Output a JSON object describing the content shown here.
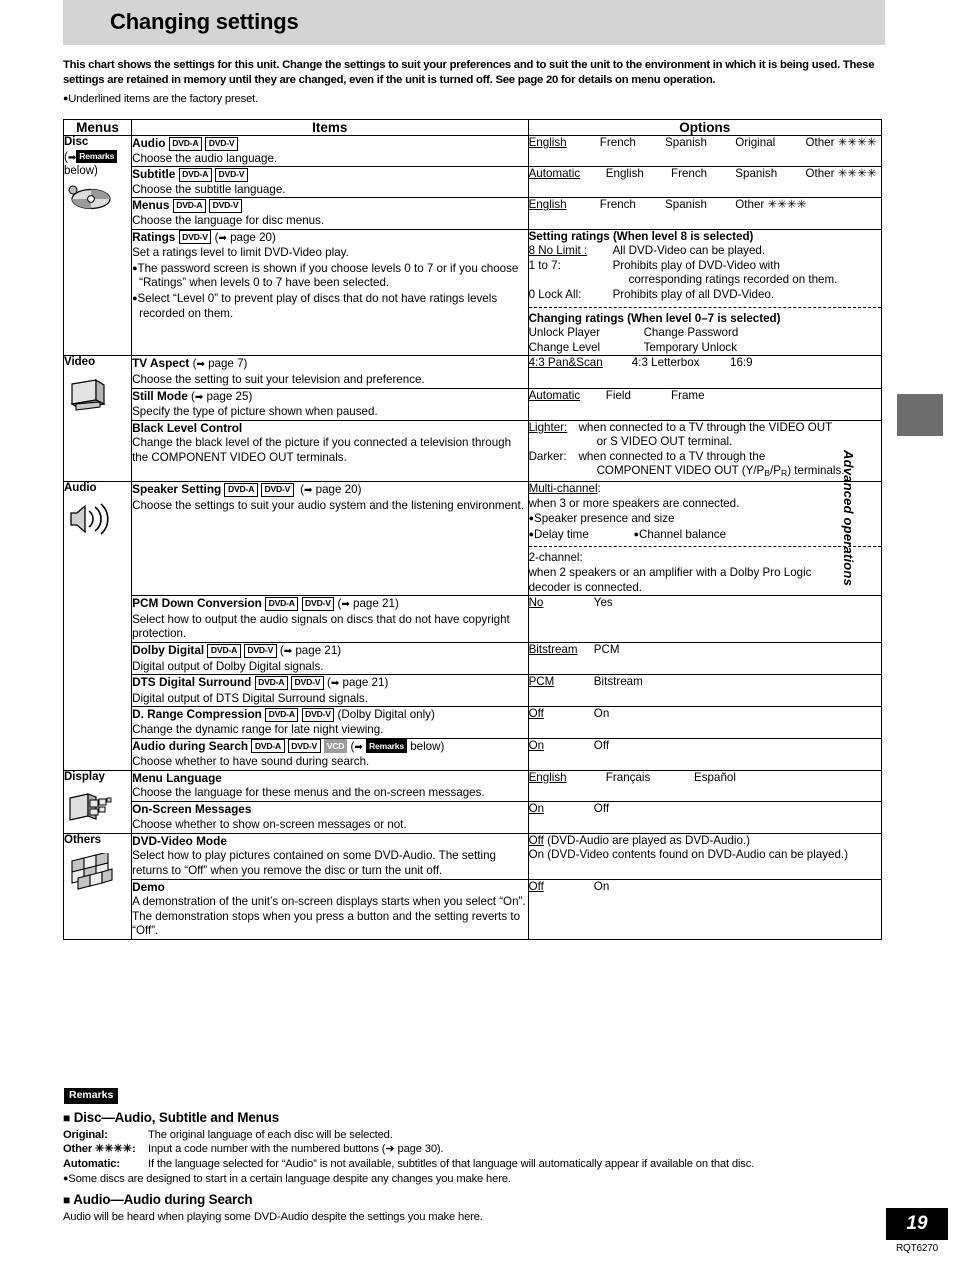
{
  "page": {
    "title": "Changing settings",
    "intro": "This chart shows the settings for this unit. Change the settings to suit your preferences and to suit the unit to the environment in which it is being used. These settings are retained in memory until they are changed, even if the unit is turned off. See page 20 for details on menu operation.",
    "intro_bullet": "Underlined items are the factory preset.",
    "side_label": "Advanced operations",
    "page_number": "19",
    "doc_code": "RQT6270"
  },
  "table": {
    "headers": {
      "menus": "Menus",
      "items": "Items",
      "options": "Options"
    },
    "groups": [
      {
        "name": "Disc",
        "note_prefix": "(",
        "note_badge": "Remarks",
        "note_suffix": "below)",
        "icon": "disc-icon",
        "rows": [
          {
            "title": "Audio",
            "badges": [
              "DVD-A",
              "DVD-V"
            ],
            "desc": "Choose the audio language.",
            "options": [
              "English",
              "French",
              "Spanish",
              "Original",
              "Other ✳✳✳✳"
            ],
            "default_index": 0
          },
          {
            "title": "Subtitle",
            "badges": [
              "DVD-A",
              "DVD-V"
            ],
            "desc": "Choose the subtitle language.",
            "options": [
              "Automatic",
              "English",
              "French",
              "Spanish",
              "Other ✳✳✳✳"
            ],
            "default_index": 0
          },
          {
            "title": "Menus",
            "badges": [
              "DVD-A",
              "DVD-V"
            ],
            "desc": "Choose the language for disc menus.",
            "options": [
              "English",
              "French",
              "Spanish",
              "Other ✳✳✳✳"
            ],
            "default_index": 0
          },
          {
            "title": "Ratings",
            "badges": [
              "DVD-V"
            ],
            "page_ref": "page 20",
            "desc": "Set a ratings level to limit DVD-Video play.",
            "bullets": [
              "The password screen is shown if you choose levels 0 to 7 or if you choose “Ratings” when levels 0 to 7 have been selected.",
              "Select “Level 0” to prevent play of discs that do not have ratings levels recorded on them."
            ],
            "options_blocks": [
              {
                "heading": "Setting ratings (When level 8 is selected)",
                "lines": [
                  {
                    "label": "8 No Limit :",
                    "text": "All DVD-Video can be played.",
                    "underline": true
                  },
                  {
                    "label": "1 to 7:",
                    "text": "Prohibits play of DVD-Video with"
                  },
                  {
                    "label": "",
                    "text": "corresponding ratings recorded on them."
                  },
                  {
                    "label": "0 Lock All:",
                    "text": "Prohibits play of all DVD-Video."
                  }
                ]
              },
              {
                "heading": "Changing ratings (When level 0–7 is selected)",
                "lines": [
                  {
                    "label": "Unlock Player",
                    "text": "Change Password"
                  },
                  {
                    "label": "Change Level",
                    "text": "Temporary Unlock"
                  }
                ]
              }
            ]
          }
        ]
      },
      {
        "name": "Video",
        "icon": "television-icon",
        "rows": [
          {
            "title": "TV Aspect",
            "page_ref": "page 7",
            "desc": "Choose the setting to suit your television and preference.",
            "options": [
              "4:3 Pan&Scan",
              "4:3 Letterbox",
              "16:9"
            ],
            "default_index": 0
          },
          {
            "title": "Still Mode",
            "page_ref": "page 25",
            "desc": "Specify the type of picture shown when paused.",
            "options": [
              "Automatic",
              "Field",
              "Frame"
            ],
            "default_index": 0
          },
          {
            "title": "Black Level Control",
            "desc": "Change the black level of the picture if you connected a television through the COMPONENT VIDEO OUT terminals.",
            "options_lines": [
              {
                "label": "Lighter:",
                "underline": true,
                "text": "when connected to a TV through the VIDEO OUT"
              },
              {
                "label": "",
                "text": "or S VIDEO OUT terminal."
              },
              {
                "label": "Darker:",
                "text": "when connected to a TV through the"
              },
              {
                "label": "",
                "text": "COMPONENT VIDEO OUT (Y/PB/PR) terminals."
              }
            ]
          }
        ]
      },
      {
        "name": "Audio",
        "icon": "speaker-icon",
        "rows": [
          {
            "title": "Speaker Setting",
            "badges": [
              "DVD-A",
              "DVD-V"
            ],
            "page_ref": "page 20",
            "desc": "Choose the settings to suit your audio system and the listening environment.",
            "options_blocks": [
              {
                "heading_underlined": "Multi-channel",
                "heading_suffix": ":",
                "lines": [
                  {
                    "text": "when 3 or more speakers are connected."
                  }
                ],
                "bullets": [
                  "Speaker presence and size"
                ],
                "bullet_pairs": [
                  [
                    "Delay time",
                    "Channel balance"
                  ]
                ]
              },
              {
                "heading_plain": "2-channel:",
                "lines": [
                  {
                    "text": "when 2 speakers or an amplifier with a Dolby Pro Logic"
                  },
                  {
                    "text": "decoder is connected."
                  }
                ]
              }
            ]
          },
          {
            "title": "PCM Down Conversion",
            "badges": [
              "DVD-A",
              "DVD-V"
            ],
            "page_ref": "page 21",
            "desc": "Select how to output the audio signals on discs that do not have copyright protection.",
            "options": [
              "No",
              "Yes"
            ],
            "default_index": 0
          },
          {
            "title": "Dolby Digital",
            "badges": [
              "DVD-A",
              "DVD-V"
            ],
            "page_ref": "page 21",
            "desc": "Digital output of Dolby Digital signals.",
            "options": [
              "Bitstream",
              "PCM"
            ],
            "default_index": 0
          },
          {
            "title": "DTS Digital Surround",
            "badges": [
              "DVD-A",
              "DVD-V"
            ],
            "page_ref": "page 21",
            "desc": "Digital output of DTS Digital Surround signals.",
            "options": [
              "PCM",
              "Bitstream"
            ],
            "default_index": 0
          },
          {
            "title": "D. Range Compression",
            "badges": [
              "DVD-A",
              "DVD-V"
            ],
            "paren_note": "(Dolby Digital only)",
            "desc": "Change the dynamic range for late night viewing.",
            "options": [
              "Off",
              "On"
            ],
            "default_index": 0
          },
          {
            "title": "Audio during Search",
            "badges": [
              "DVD-A",
              "DVD-V"
            ],
            "badge_gray": "VCD",
            "remark_note": "Remarks",
            "remark_suffix": "below)",
            "desc": "Choose whether to have sound during search.",
            "options": [
              "On",
              "Off"
            ],
            "default_index": 0
          }
        ]
      },
      {
        "name": "Display",
        "icon": "display-screens-icon",
        "rows": [
          {
            "title": "Menu Language",
            "desc": "Choose the language for these menus and the on-screen messages.",
            "options": [
              "English",
              "Français",
              "Español"
            ],
            "default_index": 0
          },
          {
            "title": "On-Screen Messages",
            "desc": "Choose whether to show on-screen messages or not.",
            "options": [
              "On",
              "Off"
            ],
            "default_index": 0
          }
        ]
      },
      {
        "name": "Others",
        "icon": "checker-tiles-icon",
        "rows": [
          {
            "title": "DVD-Video Mode",
            "desc": "Select how to play pictures contained on some DVD-Audio. The setting returns to “Off” when you remove the disc or turn the unit off.",
            "options_lines": [
              {
                "label": "Off",
                "underline": true,
                "text": "(DVD-Audio are played as DVD-Audio.)"
              },
              {
                "label": "On",
                "text": "(DVD-Video contents found on DVD-Audio can be played.)"
              }
            ]
          },
          {
            "title": "Demo",
            "desc": "A demonstration of the unit’s on-screen displays starts when you select “On”. The demonstration stops when you press a button and the setting reverts to “Off”.",
            "options": [
              "Off",
              "On"
            ],
            "default_index": 0
          }
        ]
      }
    ]
  },
  "remarks": {
    "tag": "Remarks",
    "sections": [
      {
        "heading": "Disc—Audio, Subtitle and Menus",
        "lines": [
          {
            "label": "Original:",
            "text": "The original language of each disc will be selected."
          },
          {
            "label": "Other ✳✳✳✳:",
            "text": "Input a code number with the numbered buttons (➜ page 30)."
          },
          {
            "label": "Automatic:",
            "text": "If the language selected for “Audio” is not available, subtitles of that language will automatically appear if available on that disc."
          }
        ],
        "bullet": "Some discs are designed to start in a certain language despite any changes you make here."
      },
      {
        "heading": "Audio—Audio during Search",
        "plain": "Audio will be heard when playing some DVD-Audio despite the settings you make here."
      }
    ]
  }
}
